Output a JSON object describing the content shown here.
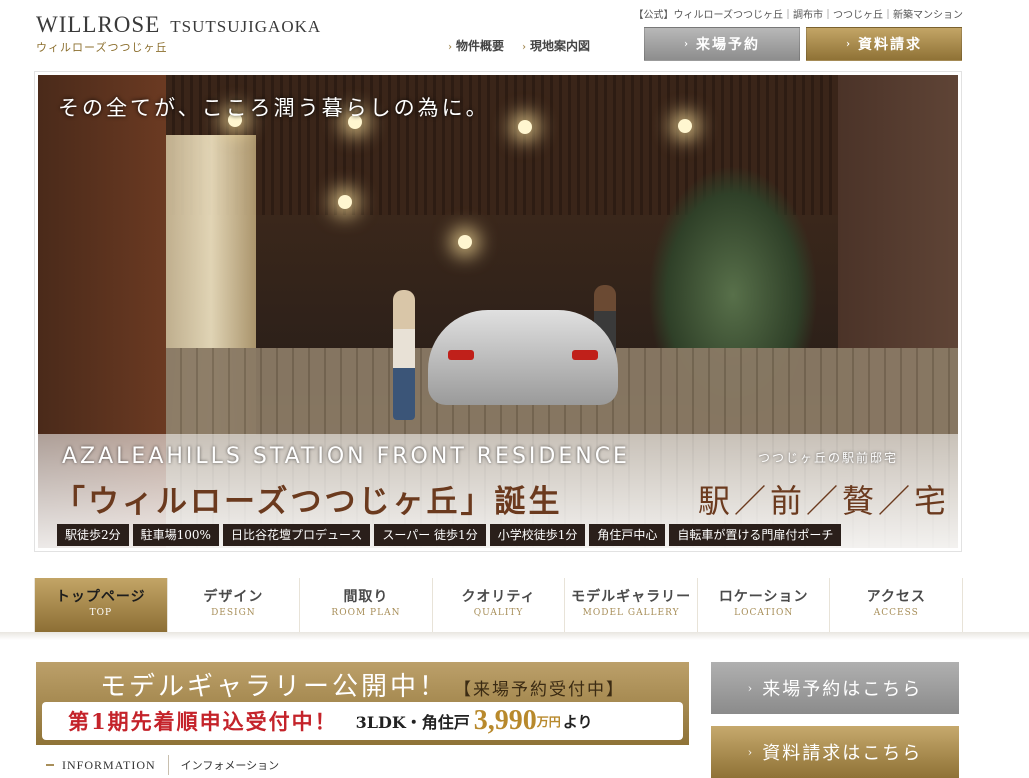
{
  "header": {
    "logo_main": "WILLROSE",
    "logo_sub": "TSUTSUJIGAOKA",
    "logo_jp": "ウィルローズつつじヶ丘",
    "breadcrumb": "【公式】ウィルローズつつじヶ丘｜調布市｜つつじヶ丘｜新築マンション",
    "nav": [
      "物件概要",
      "現地案内図"
    ],
    "visit_button": "来場予約",
    "materials_button": "資料請求"
  },
  "hero": {
    "caption": "その全てが、こころ潤う暮らしの為に。",
    "english": "AZALEAHILLS STATION FRONT RESIDENCE",
    "english_jp": "つつじヶ丘の駅前邸宅",
    "title": "「ウィルローズつつじヶ丘」誕生",
    "tagline": "駅／前／贅／宅",
    "tags": [
      "駅徒歩2分",
      "駐車場100%",
      "日比谷花壇プロデュース",
      "スーパー 徒歩1分",
      "小学校徒歩1分",
      "角住戸中心",
      "自転車が置ける門扉付ポーチ"
    ]
  },
  "global_nav": [
    {
      "ja": "トップページ",
      "en": "TOP"
    },
    {
      "ja": "デザイン",
      "en": "DESIGN"
    },
    {
      "ja": "間取り",
      "en": "ROOM PLAN"
    },
    {
      "ja": "クオリティ",
      "en": "QUALITY"
    },
    {
      "ja": "モデルギャラリー",
      "en": "MODEL GALLERY"
    },
    {
      "ja": "ロケーション",
      "en": "LOCATION"
    },
    {
      "ja": "アクセス",
      "en": "ACCESS"
    }
  ],
  "banner": {
    "headline": "モデルギャラリー公開中！",
    "headline_sub": "【来場予約受付中】",
    "red_text": "第1期先着順申込受付中！",
    "ldk": "3LDK・角住戸",
    "price": "3,990",
    "unit": "万円",
    "suffix": "より"
  },
  "side_buttons": {
    "visit": "来場予約はこちら",
    "materials": "資料請求はこちら"
  },
  "info": {
    "en": "INFORMATION",
    "jp": "インフォメーション"
  },
  "colors": {
    "gold": "#a88f5a",
    "red": "#c4232a",
    "price": "#b8892c"
  }
}
